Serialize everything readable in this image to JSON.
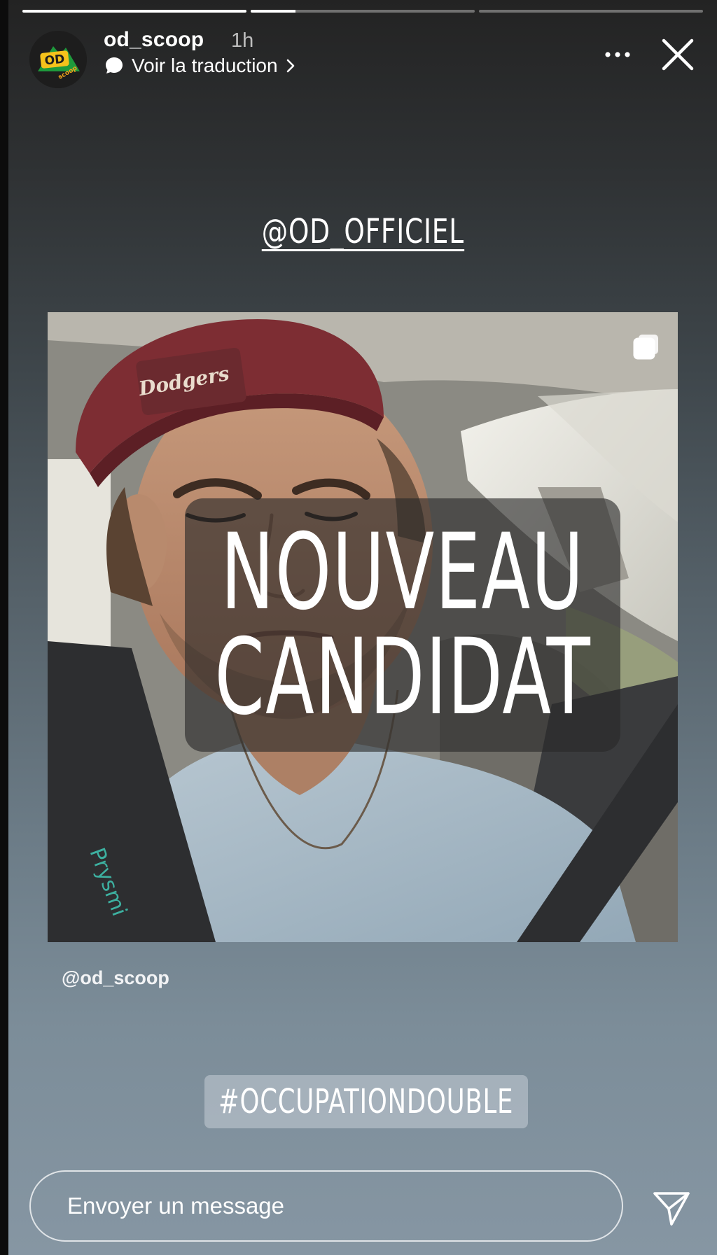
{
  "story": {
    "progress": [
      1,
      0.2,
      0
    ],
    "author": {
      "username": "od_scoop",
      "time": "1h",
      "avatar_text": "OD",
      "avatar_sub": "scoop",
      "avatar_color": "#1e9a3c"
    },
    "translate_label": "Voir la traduction",
    "mention": "@OD_OFFICIEL",
    "post": {
      "caption_line1": "NOUVEAU",
      "caption_line2": "CANDIDAT",
      "cap_text": "Dodgers",
      "shirt_text": "Prysmi"
    },
    "credit": "@od_scoop",
    "hashtag": "#OCCUPATIONDOUBLE",
    "message_placeholder": "Envoyer un message"
  },
  "icons": {
    "more": "more-horizontal-icon",
    "close": "close-icon",
    "translate": "speech-bubble-icon",
    "multi": "multiple-images-icon",
    "send": "send-paper-plane-icon"
  }
}
